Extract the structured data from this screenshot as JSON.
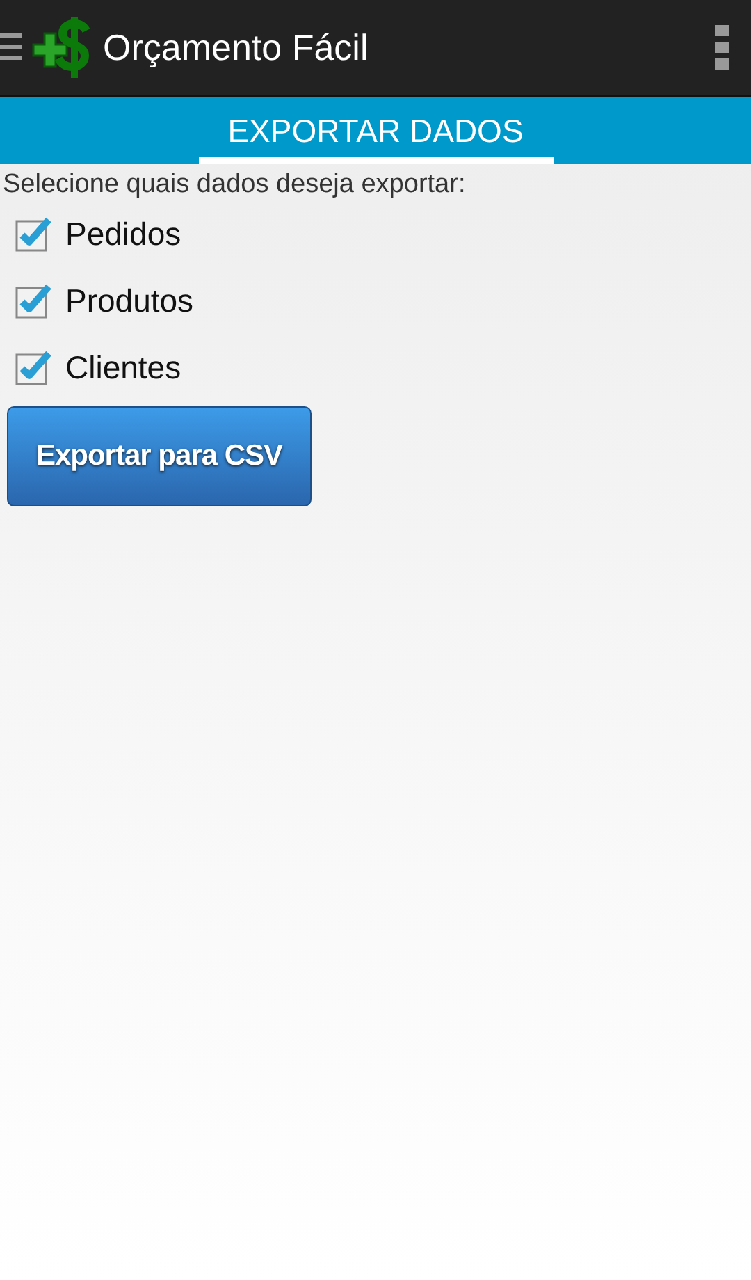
{
  "action_bar": {
    "title": "Orçamento Fácil"
  },
  "tabs": [
    {
      "label": "EXPORTAR DADOS",
      "selected": true
    }
  ],
  "prompt": "Selecione quais dados deseja exportar:",
  "options": [
    {
      "label": "Pedidos",
      "checked": true
    },
    {
      "label": "Produtos",
      "checked": true
    },
    {
      "label": "Clientes",
      "checked": true
    }
  ],
  "export_button": "Exportar para CSV"
}
